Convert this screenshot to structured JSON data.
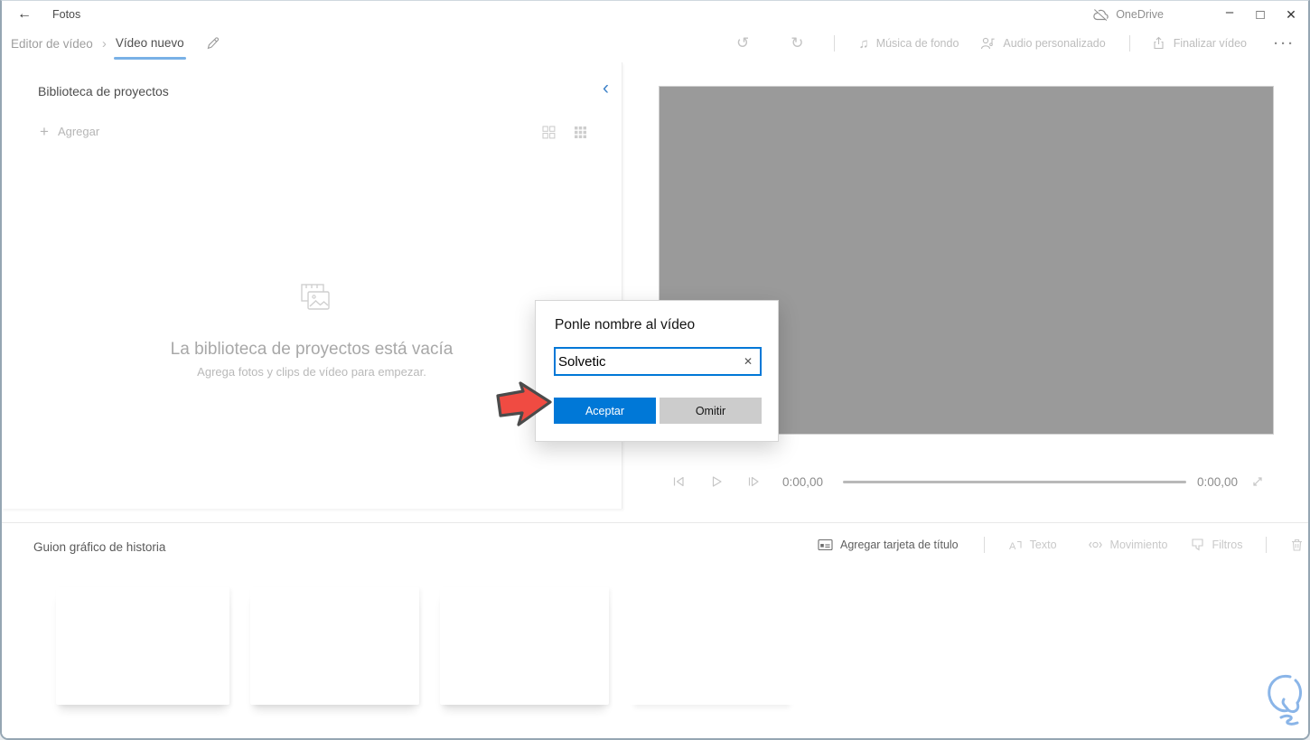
{
  "glyphs": {
    "back": "←",
    "breadcrumb_chevron": "›",
    "collapse_chevron": "‹",
    "plus": "+",
    "undo": "↺",
    "redo": "↻",
    "music_note": "♫",
    "more": "···",
    "minimize": "–",
    "maximize": "□",
    "close": "✕",
    "clear": "✕"
  },
  "titlebar": {
    "app_title": "Fotos",
    "onedrive_label": "OneDrive"
  },
  "toolbar": {
    "breadcrumb_parent": "Editor de vídeo",
    "breadcrumb_current": "Vídeo nuevo",
    "music_label": "Música de fondo",
    "custom_audio_label": "Audio personalizado",
    "finish_label": "Finalizar vídeo"
  },
  "library": {
    "title": "Biblioteca de proyectos",
    "add_label": "Agregar",
    "empty_title": "La biblioteca de proyectos está vacía",
    "empty_subtitle": "Agrega fotos y clips de vídeo para empezar."
  },
  "preview": {
    "current_time": "0:00,00",
    "total_time": "0:00,00"
  },
  "storyboard": {
    "title": "Guion gráfico de historia",
    "add_title_card_label": "Agregar tarjeta de título",
    "text_label": "Texto",
    "motion_label": "Movimiento",
    "filters_label": "Filtros"
  },
  "dialog": {
    "title": "Ponle nombre al vídeo",
    "input_value": "Solvetic",
    "accept_label": "Aceptar",
    "skip_label": "Omitir"
  },
  "colors": {
    "accent_blue": "#0078d7",
    "underline_blue": "#79b1e6",
    "arrow_red": "#f04b42",
    "preview_gray": "#9a9a9a",
    "watermark_blue": "#8ab5e8"
  }
}
